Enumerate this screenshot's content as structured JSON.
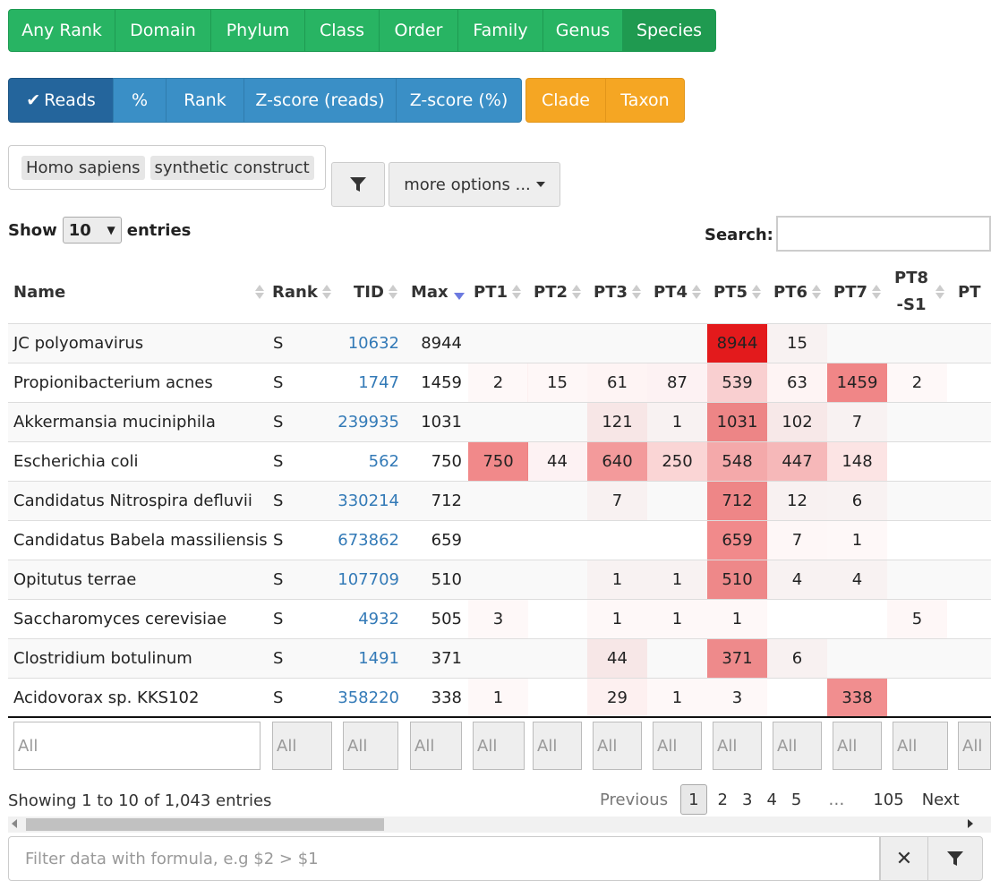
{
  "rank_buttons": [
    "Any Rank",
    "Domain",
    "Phylum",
    "Class",
    "Order",
    "Family",
    "Genus",
    "Species"
  ],
  "rank_active": "Species",
  "metric_buttons": [
    "Reads",
    "%",
    "Rank",
    "Z-score (reads)",
    "Z-score (%)"
  ],
  "metric_active": "Reads",
  "mode_buttons": [
    "Clade",
    "Taxon"
  ],
  "exclude_tags": [
    "Homo sapiens",
    "synthetic construct"
  ],
  "more_options": "more options ...",
  "show_label": "Show",
  "entries_label": "entries",
  "page_length": "10",
  "search_label": "Search:",
  "columns": [
    "Name",
    "Rank",
    "TID",
    "Max",
    "PT1",
    "PT2",
    "PT3",
    "PT4",
    "PT5",
    "PT6",
    "PT7",
    "PT8-S1",
    "PT"
  ],
  "rows": [
    {
      "name": "JC polyomavirus",
      "rank": "S",
      "tid": "10632",
      "max": "8944",
      "pt": [
        "",
        "",
        "",
        "",
        "8944",
        "15",
        "",
        ""
      ]
    },
    {
      "name": "Propionibacterium acnes",
      "rank": "S",
      "tid": "1747",
      "max": "1459",
      "pt": [
        "2",
        "15",
        "61",
        "87",
        "539",
        "63",
        "1459",
        "2"
      ]
    },
    {
      "name": "Akkermansia muciniphila",
      "rank": "S",
      "tid": "239935",
      "max": "1031",
      "pt": [
        "",
        "",
        "121",
        "1",
        "1031",
        "102",
        "7",
        ""
      ]
    },
    {
      "name": "Escherichia coli",
      "rank": "S",
      "tid": "562",
      "max": "750",
      "pt": [
        "750",
        "44",
        "640",
        "250",
        "548",
        "447",
        "148",
        ""
      ]
    },
    {
      "name": "Candidatus Nitrospira defluvii",
      "rank": "S",
      "tid": "330214",
      "max": "712",
      "pt": [
        "",
        "",
        "7",
        "",
        "712",
        "12",
        "6",
        ""
      ]
    },
    {
      "name": "Candidatus Babela massiliensis",
      "rank": "S",
      "tid": "673862",
      "max": "659",
      "pt": [
        "",
        "",
        "",
        "",
        "659",
        "7",
        "1",
        ""
      ]
    },
    {
      "name": "Opitutus terrae",
      "rank": "S",
      "tid": "107709",
      "max": "510",
      "pt": [
        "",
        "",
        "1",
        "1",
        "510",
        "4",
        "4",
        ""
      ]
    },
    {
      "name": "Saccharomyces cerevisiae",
      "rank": "S",
      "tid": "4932",
      "max": "505",
      "pt": [
        "3",
        "",
        "1",
        "1",
        "1",
        "",
        "",
        "5"
      ]
    },
    {
      "name": "Clostridium botulinum",
      "rank": "S",
      "tid": "1491",
      "max": "371",
      "pt": [
        "",
        "",
        "44",
        "",
        "371",
        "6",
        "",
        ""
      ]
    },
    {
      "name": "Acidovorax sp. KKS102",
      "rank": "S",
      "tid": "358220",
      "max": "338",
      "pt": [
        "1",
        "",
        "29",
        "1",
        "3",
        "",
        "338",
        ""
      ]
    }
  ],
  "filter_placeholder": "All",
  "info_text": "Showing 1 to 10 of 1,043 entries",
  "pager": {
    "prev": "Previous",
    "pages": [
      "1",
      "2",
      "3",
      "4",
      "5",
      "…",
      "105"
    ],
    "next": "Next"
  },
  "formula_placeholder": "Filter data with formula, e.g $2 > $1",
  "colors": {
    "green": "#28b463",
    "blue": "#3a8fc6",
    "blue_active": "#24659c",
    "orange": "#f5a623",
    "heat_max": "#e31a1c"
  }
}
